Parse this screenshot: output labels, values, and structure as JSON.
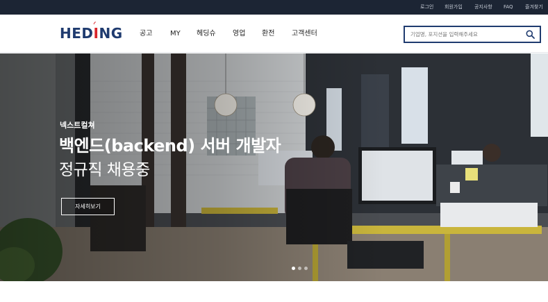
{
  "topbar": {
    "links": [
      "로그인",
      "회원가입",
      "공지사항",
      "FAQ",
      "즐겨찾기"
    ]
  },
  "header": {
    "logo": {
      "text_main": "HED",
      "text_accent": "I",
      "text_tail": "NG"
    },
    "nav": [
      "공고",
      "MY",
      "헤딩슈",
      "영업",
      "환전",
      "고객센터"
    ],
    "search": {
      "placeholder": "기업명, 포지션을 입력해주세요",
      "value": "",
      "icon": "search-icon"
    }
  },
  "hero": {
    "company": "넥스트컬쳐",
    "title": "백엔드(backend) 서버 개발자",
    "subtitle": "정규직 채용중",
    "cta_label": "자세히보기",
    "slides": {
      "count": 3,
      "active": 0
    }
  },
  "colors": {
    "topbar_bg": "#1c2534",
    "brand_navy": "#1f3b6f",
    "brand_red": "#d9262c"
  }
}
